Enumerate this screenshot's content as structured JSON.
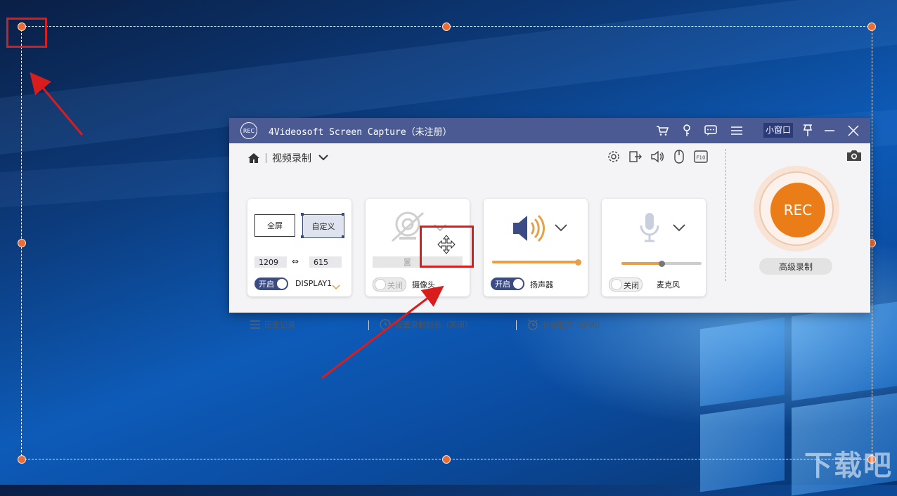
{
  "window": {
    "title": "4Videosoft Screen Capture（未注册）",
    "logo_text": "REC",
    "mini_window_label": "小窗口",
    "icons": [
      "cart-icon",
      "key-icon",
      "chat-icon",
      "menu-icon",
      "pin-icon",
      "minimize-icon",
      "close-icon"
    ]
  },
  "mode": {
    "current": "视频录制"
  },
  "screen_card": {
    "fullscreen_label": "全屏",
    "custom_label": "自定义",
    "width": "1209",
    "height": "615",
    "toggle_label": "开启",
    "display": "DISPLAY1"
  },
  "camera_card": {
    "toggle_label": "关闭",
    "label": "摄像头"
  },
  "speaker_card": {
    "toggle_label": "开启",
    "label": "扬声器",
    "volume": 1.0
  },
  "mic_card": {
    "toggle_label": "关闭",
    "label": "麦克风",
    "volume": 0.5
  },
  "record": {
    "button_label": "REC",
    "advanced_label": "高级录制"
  },
  "footer": {
    "history": "历史记录",
    "duration": "设置录制时长（关闭）",
    "schedule": "计划任务（关闭）"
  },
  "watermark": "下载吧",
  "colors": {
    "titlebar": "#4b5a92",
    "accent": "#ea7d18",
    "selection_handle": "#e96d35",
    "highlight_box": "#d91d1d"
  }
}
